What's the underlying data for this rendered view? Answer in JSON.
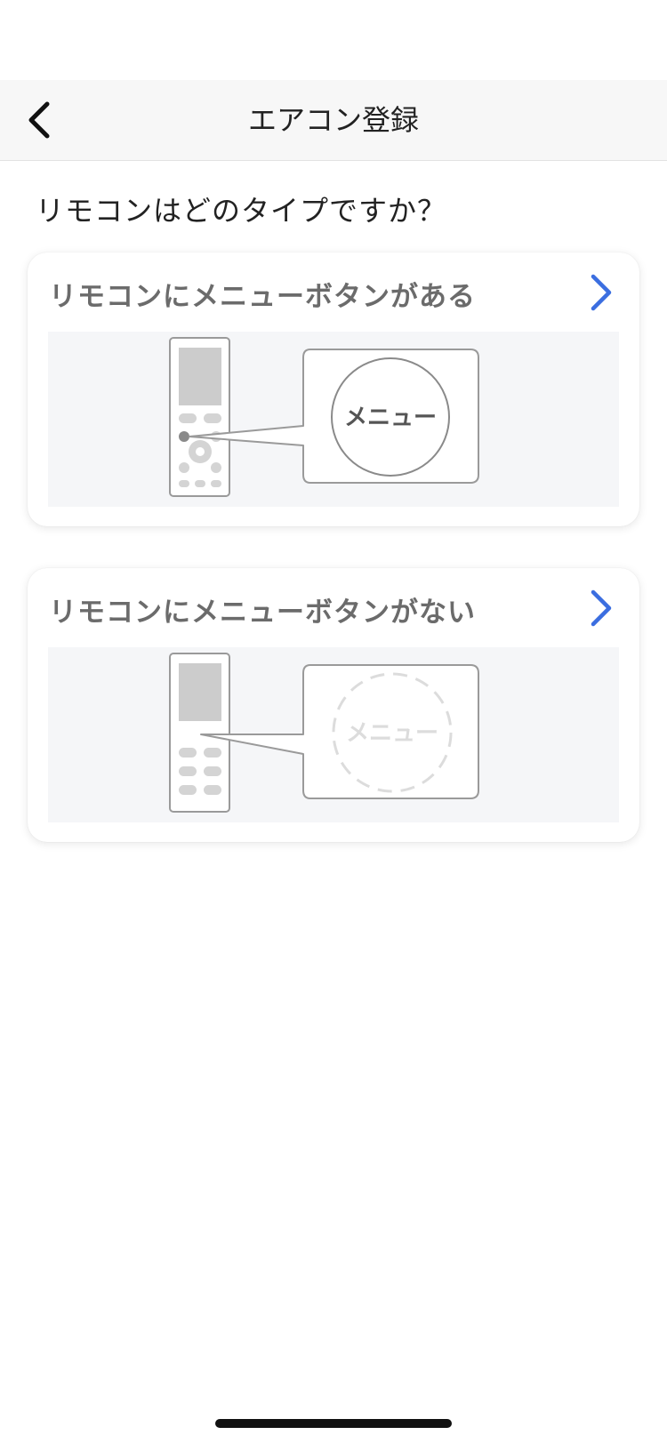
{
  "nav": {
    "title": "エアコン登録",
    "back_icon": "chevron-left-icon"
  },
  "question": "リモコンはどのタイプですか？",
  "options": [
    {
      "title": "リモコンにメニューボタンがある",
      "chevron_icon": "chevron-right-icon",
      "illustration_label": "メニュー"
    },
    {
      "title": "リモコンにメニューボタンがない",
      "chevron_icon": "chevron-right-icon",
      "illustration_label": "メニュー"
    }
  ],
  "colors": {
    "accent": "#3b6ee0",
    "nav_background": "#f7f7f7",
    "card_title": "#6b6b6b",
    "illustration_background": "#f5f6f8"
  }
}
